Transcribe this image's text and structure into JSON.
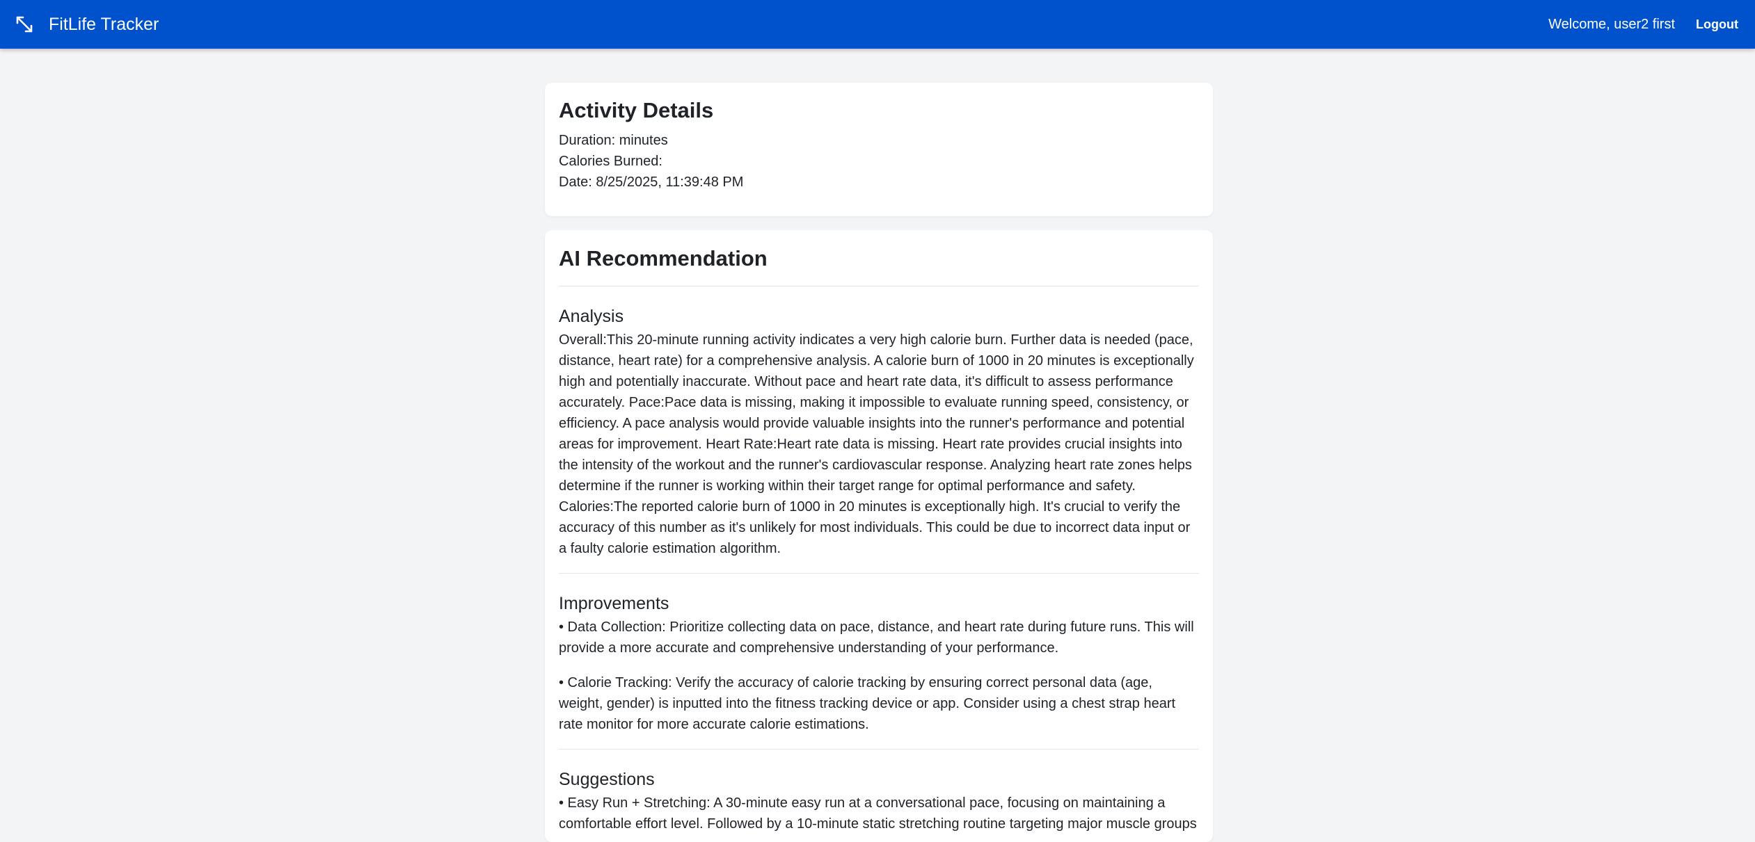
{
  "header": {
    "brand_icon": "expand-arrows-icon",
    "title": "FitLife Tracker",
    "welcome": "Welcome, user2 first",
    "logout_label": "Logout",
    "bar_color": "#0052cc"
  },
  "activity": {
    "heading": "Activity Details",
    "duration": "Duration: minutes",
    "calories": "Calories Burned:",
    "date": "Date: 8/25/2025, 11:39:48 PM"
  },
  "ai": {
    "heading": "AI Recommendation",
    "analysis": {
      "heading": "Analysis",
      "text": "Overall:This 20-minute running activity indicates a very high calorie burn. Further data is needed (pace, distance, heart rate) for a comprehensive analysis. A calorie burn of 1000 in 20 minutes is exceptionally high and potentially inaccurate. Without pace and heart rate data, it's difficult to assess performance accurately. Pace:Pace data is missing, making it impossible to evaluate running speed, consistency, or efficiency. A pace analysis would provide valuable insights into the runner's performance and potential areas for improvement. Heart Rate:Heart rate data is missing. Heart rate provides crucial insights into the intensity of the workout and the runner's cardiovascular response. Analyzing heart rate zones helps determine if the runner is working within their target range for optimal performance and safety. Calories:The reported calorie burn of 1000 in 20 minutes is exceptionally high. It's crucial to verify the accuracy of this number as it's unlikely for most individuals. This could be due to incorrect data input or a faulty calorie estimation algorithm."
    },
    "improvements": {
      "heading": "Improvements",
      "items": [
        "• Data Collection: Prioritize collecting data on pace, distance, and heart rate during future runs. This will provide a more accurate and comprehensive understanding of your performance.",
        "• Calorie Tracking: Verify the accuracy of calorie tracking by ensuring correct personal data (age, weight, gender) is inputted into the fitness tracking device or app. Consider using a chest strap heart rate monitor for more accurate calorie estimations."
      ]
    },
    "suggestions": {
      "heading": "Suggestions",
      "items": [
        "• Easy Run + Stretching: A 30-minute easy run at a conversational pace, focusing on maintaining a comfortable effort level. Followed by a 10-minute static stretching routine targeting major muscle groups"
      ]
    }
  }
}
